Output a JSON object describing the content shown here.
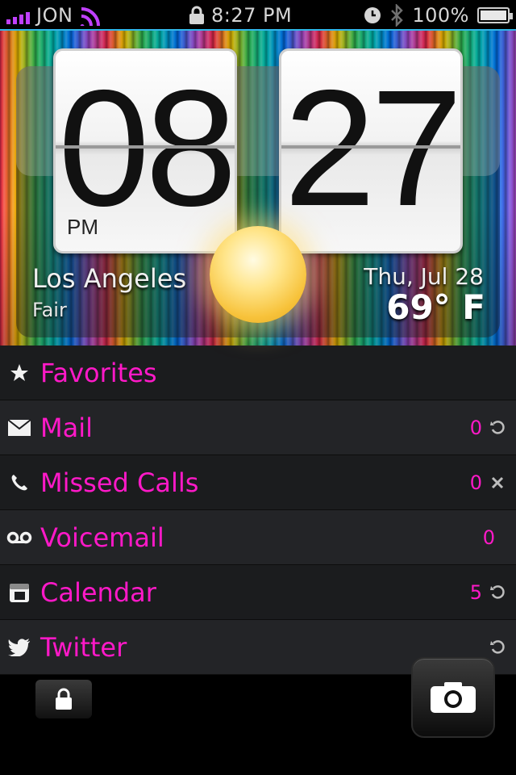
{
  "status_bar": {
    "carrier": "JON",
    "time": "8:27 PM",
    "battery": "100%"
  },
  "clock": {
    "hours": "08",
    "minutes": "27",
    "ampm": "PM"
  },
  "weather": {
    "city": "Los Angeles",
    "condition": "Fair",
    "date": "Thu, Jul 28",
    "temperature": "69° F"
  },
  "notifications": [
    {
      "label": "Favorites",
      "icon": "star-icon"
    },
    {
      "label": "Mail",
      "icon": "mail-icon",
      "count": "0",
      "action": "refresh-icon"
    },
    {
      "label": "Missed Calls",
      "icon": "phone-icon",
      "count": "0",
      "action": "clear-icon"
    },
    {
      "label": "Voicemail",
      "icon": "voicemail-icon",
      "count": "0"
    },
    {
      "label": "Calendar",
      "icon": "calendar-icon",
      "count": "5",
      "action": "refresh-icon"
    },
    {
      "label": "Twitter",
      "icon": "twitter-bird-icon",
      "action": "refresh-icon"
    }
  ],
  "colors": {
    "accent_pink": "#ff19c8",
    "status_line": "#31b6e8",
    "signal_purple": "#c040ff"
  },
  "controls": {
    "lock_icon": "lock-icon",
    "camera_icon": "camera-icon"
  }
}
